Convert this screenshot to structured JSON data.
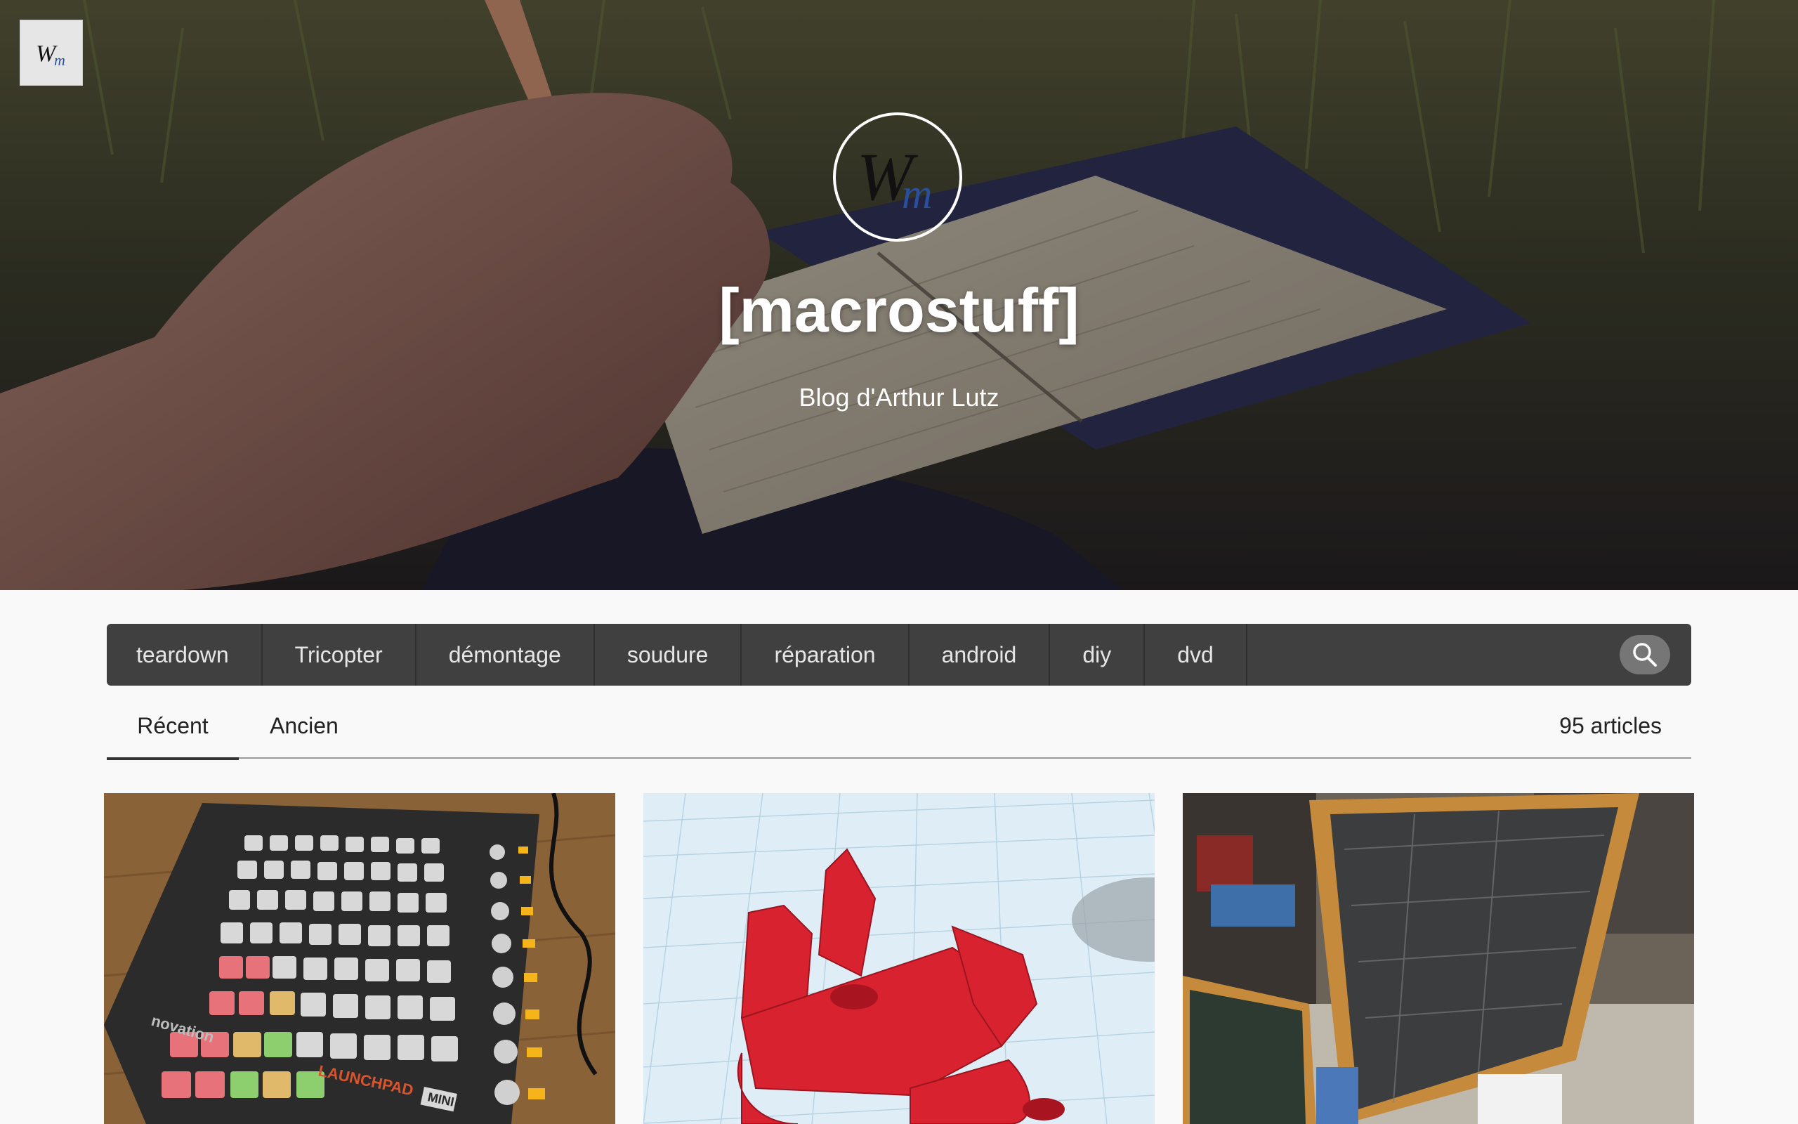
{
  "header": {
    "title": "[macrostuff]",
    "subtitle": "Blog d'Arthur Lutz",
    "logo_icon": "wm-monogram-logo"
  },
  "tags": [
    "teardown",
    "Tricopter",
    "démontage",
    "soudure",
    "réparation",
    "android",
    "diy",
    "dvd"
  ],
  "search": {
    "icon": "search-icon"
  },
  "sort": {
    "tabs": [
      "Récent",
      "Ancien"
    ],
    "active": "Récent",
    "count_label": "95 articles"
  },
  "cards": [
    {
      "name": "launchpad-photo",
      "label_main": "LAUNCHPAD",
      "label_mini": "MINI",
      "brand": "novation"
    },
    {
      "name": "3d-printed-part-render"
    },
    {
      "name": "workshop-window-frames-photo"
    }
  ],
  "colors": {
    "tagbar_bg": "#404040",
    "page_bg": "#f9f9f9",
    "accent_red": "#d8222f"
  }
}
